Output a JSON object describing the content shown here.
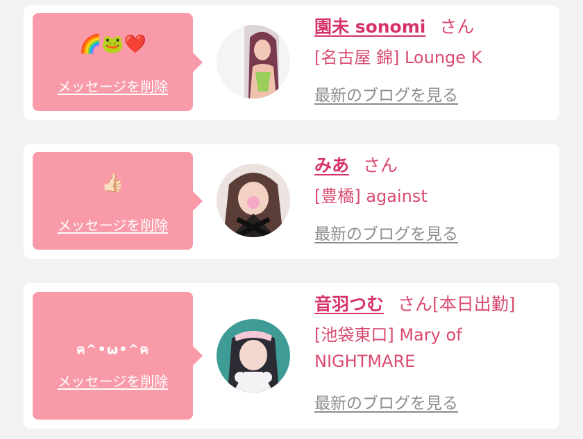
{
  "delete_label": "メッセージを削除",
  "blog_label": "最新のブログを見る",
  "honorific": "さん",
  "colors": {
    "background": "#f2f2f2",
    "card": "#ffffff",
    "bubble": "#f99aa8",
    "name": "#d6336c",
    "shop": "#d94a6e",
    "link_gray": "#8c8c8c"
  },
  "items": [
    {
      "message": "🌈🐸❤️",
      "name": "園未 sonomi",
      "status": "",
      "shop": "[名古屋 錦] Lounge K"
    },
    {
      "message": "👍🏻",
      "name": "みあ",
      "status": "",
      "shop": "[豊橋] against"
    },
    {
      "message": "ฅ^•ω•^ฅ",
      "name": "音羽つむ",
      "status": "[本日出勤]",
      "shop": "[池袋東口] Mary of NIGHTMARE"
    }
  ]
}
